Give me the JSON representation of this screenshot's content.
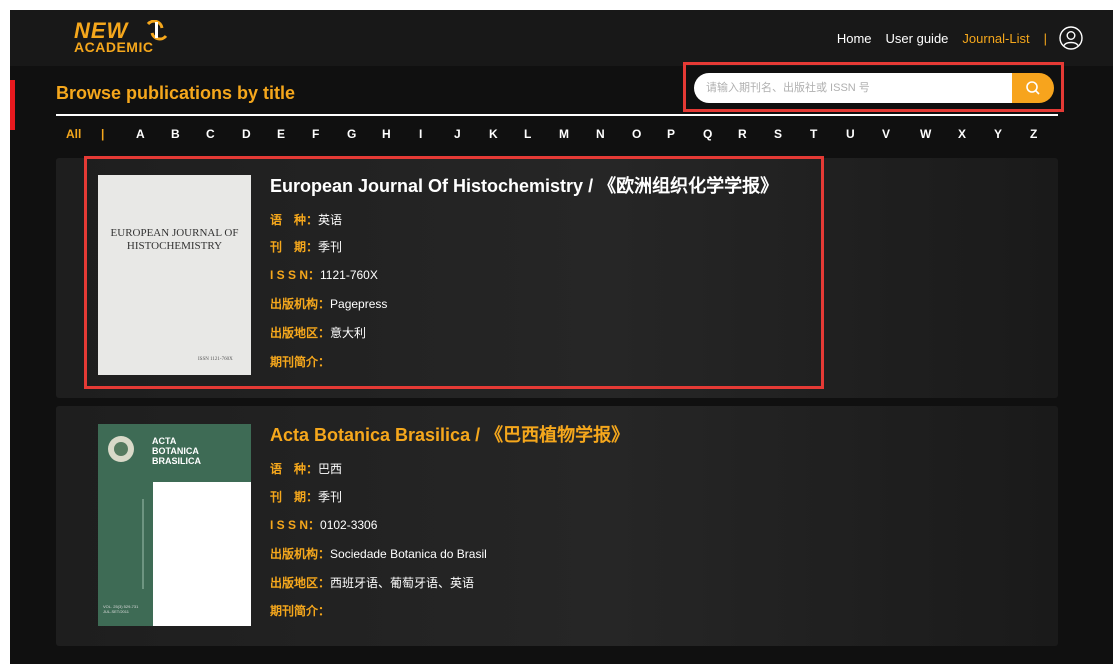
{
  "header": {
    "logo_line1": "NEW",
    "logo_line2": "ACADEMIC",
    "nav": [
      {
        "label": "Home",
        "active": false
      },
      {
        "label": "User guide",
        "active": false
      },
      {
        "label": "Journal-List",
        "active": true
      }
    ],
    "separator": "|",
    "user_icon": "user-circle-icon"
  },
  "page": {
    "heading": "Browse publications by title",
    "search": {
      "placeholder": "请输入期刊名、出版社或 ISSN 号",
      "value": "",
      "button_icon": "search-icon"
    },
    "alphabet": [
      "All",
      "|",
      "A",
      "B",
      "C",
      "D",
      "E",
      "F",
      "G",
      "H",
      "I",
      "J",
      "K",
      "L",
      "M",
      "N",
      "O",
      "P",
      "Q",
      "R",
      "S",
      "T",
      "U",
      "V",
      "W",
      "X",
      "Y",
      "Z"
    ]
  },
  "journals": [
    {
      "title": "European Journal Of Histochemistry / 《欧洲组织化学学报》",
      "cover_text": "EUROPEAN JOURNAL OF HISTOCHEMISTRY",
      "cover_issn": "ISSN 1121-760X",
      "fields": [
        {
          "key": "语　种：",
          "value": "英语"
        },
        {
          "key": "刊　期：",
          "value": "季刊"
        },
        {
          "key": "I S S N：",
          "value": "1121-760X"
        },
        {
          "key": "出版机构：",
          "value": "Pagepress"
        },
        {
          "key": "出版地区：",
          "value": "意大利"
        },
        {
          "key": "期刊简介：",
          "value": ""
        }
      ]
    },
    {
      "title": "Acta Botanica Brasilica / 《巴西植物学报》",
      "cover_text": "ACTA BOTANICA BRASILICA",
      "cover_volume": "VOL. 25(3) 529-731 JUL-SET/2011",
      "fields": [
        {
          "key": "语　种：",
          "value": "巴西"
        },
        {
          "key": "刊　期：",
          "value": "季刊"
        },
        {
          "key": "I S S N：",
          "value": "0102-3306"
        },
        {
          "key": "出版机构：",
          "value": "Sociedade Botanica do Brasil"
        },
        {
          "key": "出版地区：",
          "value": "西班牙语、葡萄牙语、英语"
        },
        {
          "key": "期刊简介：",
          "value": ""
        }
      ]
    }
  ],
  "colors": {
    "accent": "#f5a71c",
    "highlight": "#e53a35",
    "background": "#101010"
  }
}
